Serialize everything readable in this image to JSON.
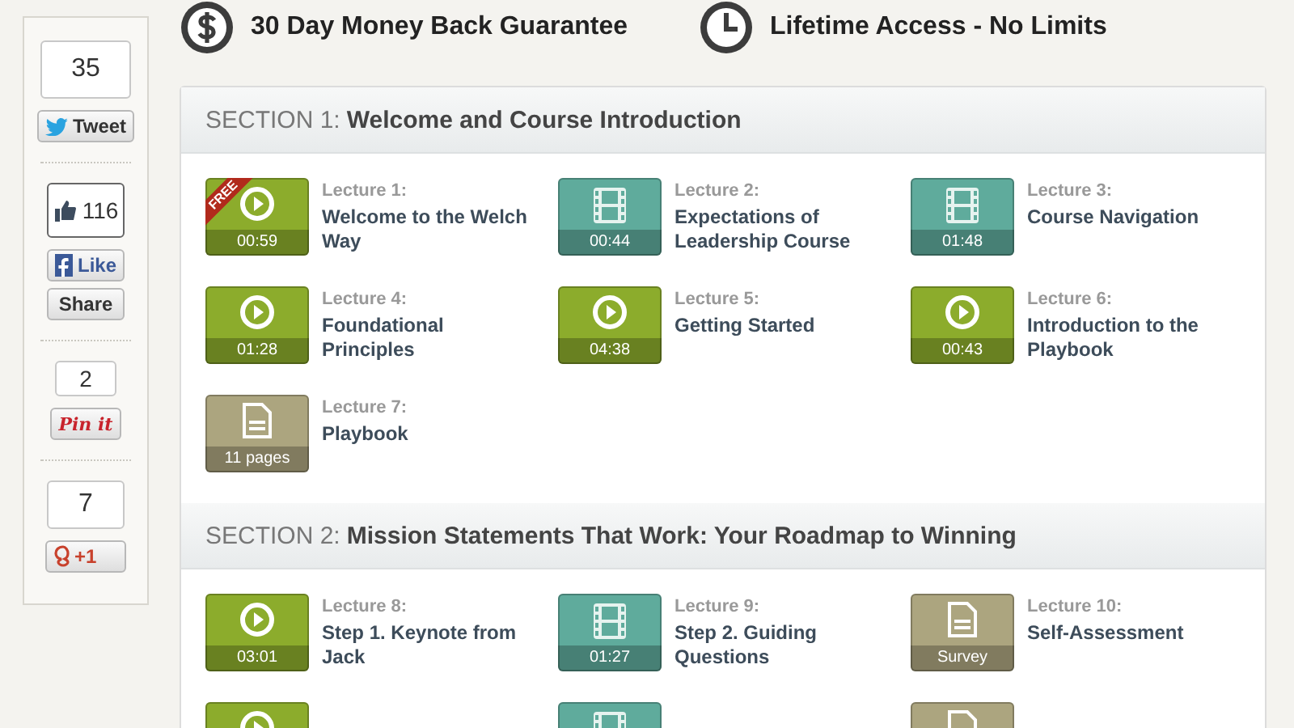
{
  "guarantees": [
    {
      "kind": "money",
      "text": "30 Day Money Back Guarantee"
    },
    {
      "kind": "clock",
      "text": "Lifetime Access - No Limits"
    }
  ],
  "social": [
    {
      "kind": "twitter",
      "count": "35",
      "buttons": [
        "Tweet"
      ]
    },
    {
      "kind": "facebook",
      "count": "116",
      "buttons": [
        "Like",
        "Share"
      ]
    },
    {
      "kind": "pinterest",
      "count": "2",
      "buttons": [
        "Pin it"
      ]
    },
    {
      "kind": "google",
      "count": "7",
      "buttons": [
        "+1"
      ]
    }
  ],
  "sections": [
    {
      "label": "SECTION 1:",
      "title": "Welcome and Course Introduction",
      "lectures": [
        {
          "number": "Lecture 1:",
          "title": "Welcome to the Welch Way",
          "kind": "video",
          "meta": "00:59",
          "free": true
        },
        {
          "number": "Lecture 2:",
          "title": "Expectations of Leadership Course",
          "kind": "film",
          "meta": "00:44",
          "free": false
        },
        {
          "number": "Lecture 3:",
          "title": "Course Navigation",
          "kind": "film",
          "meta": "01:48",
          "free": false
        },
        {
          "number": "Lecture 4:",
          "title": "Foundational Principles",
          "kind": "video",
          "meta": "01:28",
          "free": false
        },
        {
          "number": "Lecture 5:",
          "title": "Getting Started",
          "kind": "video",
          "meta": "04:38",
          "free": false
        },
        {
          "number": "Lecture 6:",
          "title": "Introduction to the Playbook",
          "kind": "video",
          "meta": "00:43",
          "free": false
        },
        {
          "number": "Lecture 7:",
          "title": "Playbook",
          "kind": "doc",
          "meta": "11 pages",
          "free": false
        }
      ]
    },
    {
      "label": "SECTION 2:",
      "title": "Mission Statements That Work: Your Roadmap to Winning",
      "lectures": [
        {
          "number": "Lecture 8:",
          "title": "Step 1. Keynote from Jack",
          "kind": "video",
          "meta": "03:01",
          "free": false
        },
        {
          "number": "Lecture 9:",
          "title": "Step 2. Guiding Questions",
          "kind": "film",
          "meta": "01:27",
          "free": false
        },
        {
          "number": "Lecture 10:",
          "title": "Self-Assessment",
          "kind": "doc",
          "meta": "Survey",
          "free": false
        },
        {
          "kind": "video"
        },
        {
          "kind": "film"
        },
        {
          "kind": "doc"
        }
      ]
    }
  ],
  "free_ribbon": "FREE"
}
